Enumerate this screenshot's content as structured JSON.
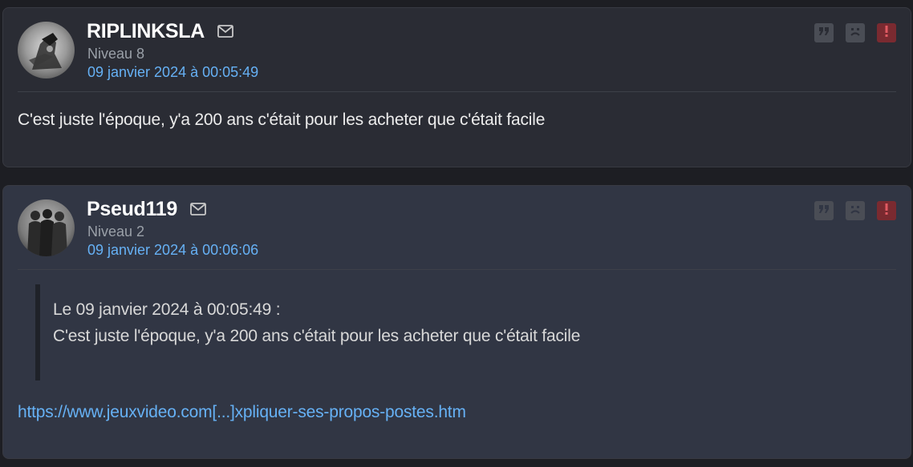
{
  "posts": [
    {
      "author": "RIPLINKSLA",
      "level": "Niveau 8",
      "date": "09 janvier 2024 à 00:05:49",
      "content": "C'est juste l'époque, y'a 200 ans c'était pour les acheter que c'était facile"
    },
    {
      "author": "Pseud119",
      "level": "Niveau 2",
      "date": "09 janvier 2024 à 00:06:06",
      "quote": {
        "header": "Le 09 janvier 2024 à 00:05:49 :",
        "text": "C'est juste l'époque, y'a 200 ans c'était pour les acheter que c'était facile"
      },
      "link": "https://www.jeuxvideo.com[...]xpliquer-ses-propos-postes.htm"
    }
  ],
  "icons": {
    "mail": "mail-icon",
    "quote": "quote-icon",
    "sad": "sad-face-icon",
    "report": "exclamation-icon"
  },
  "colors": {
    "background": "#1d1e23",
    "post1_bg": "#2a2c34",
    "post2_bg": "#313644",
    "link": "#66b1f5",
    "report": "#7a2a30"
  }
}
